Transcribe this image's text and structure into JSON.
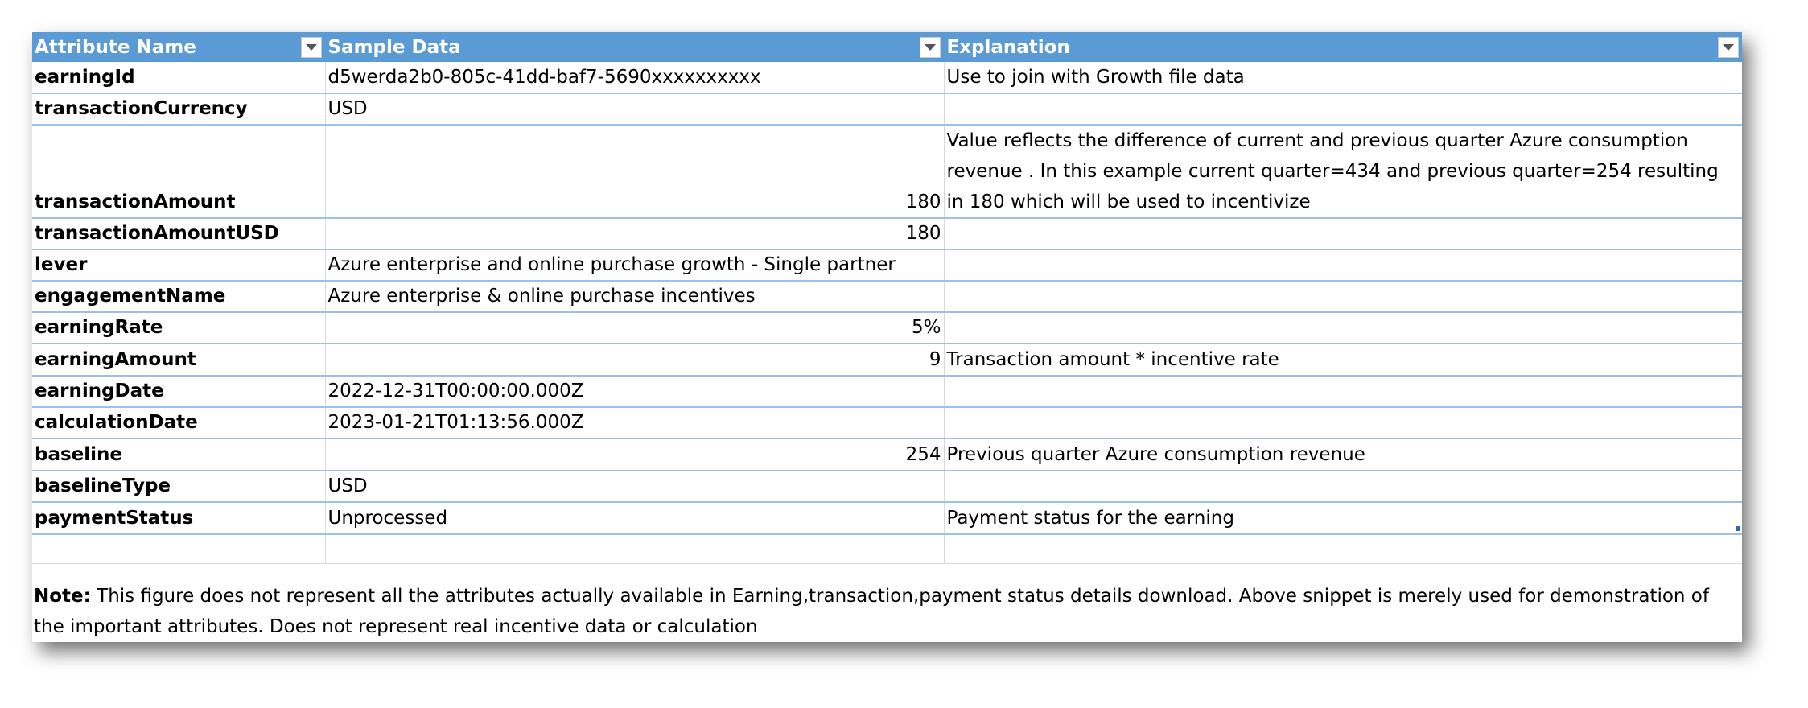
{
  "table": {
    "headers": [
      "Attribute Name",
      "Sample Data",
      "Explanation"
    ],
    "rows": [
      {
        "attr": "earningId",
        "sample": "d5werda2b0-805c-41dd-baf7-5690xxxxxxxxxx",
        "expl": "Use to join with Growth file data"
      },
      {
        "attr": "transactionCurrency",
        "sample": "USD",
        "expl": ""
      },
      {
        "attr": "transactionAmount",
        "sample": "180",
        "expl": "Value reflects the difference of current and previous quarter  Azure consumption revenue . In this example current quarter=434 and previous quarter=254 resulting in 180 which will be used to incentivize"
      },
      {
        "attr": "transactionAmountUSD",
        "sample": "180",
        "expl": ""
      },
      {
        "attr": "lever",
        "sample": "Azure enterprise and online purchase growth - Single partner",
        "expl": ""
      },
      {
        "attr": "engagementName",
        "sample": "Azure enterprise & online purchase incentives",
        "expl": ""
      },
      {
        "attr": "earningRate",
        "sample": "5%",
        "expl": ""
      },
      {
        "attr": "earningAmount",
        "sample": "9",
        "expl": "Transaction amount * incentive rate"
      },
      {
        "attr": "earningDate",
        "sample": "2022-12-31T00:00:00.000Z",
        "expl": ""
      },
      {
        "attr": "calculationDate",
        "sample": "2023-01-21T01:13:56.000Z",
        "expl": ""
      },
      {
        "attr": "baseline",
        "sample": "254",
        "expl": "Previous quarter Azure consumption revenue"
      },
      {
        "attr": "baselineType",
        "sample": "USD",
        "expl": ""
      },
      {
        "attr": "paymentStatus",
        "sample": "Unprocessed",
        "expl": "Payment status for the earning"
      }
    ]
  },
  "note": {
    "label": "Note:",
    "text": " This figure does not represent all the attributes actually available in Earning,transaction,payment status details download. Above snippet is merely used for demonstration of the important attributes. Does not represent real incentive data or calculation"
  },
  "colors": {
    "header_bg": "#5b9bd5",
    "row_border": "#9bc2e6"
  }
}
